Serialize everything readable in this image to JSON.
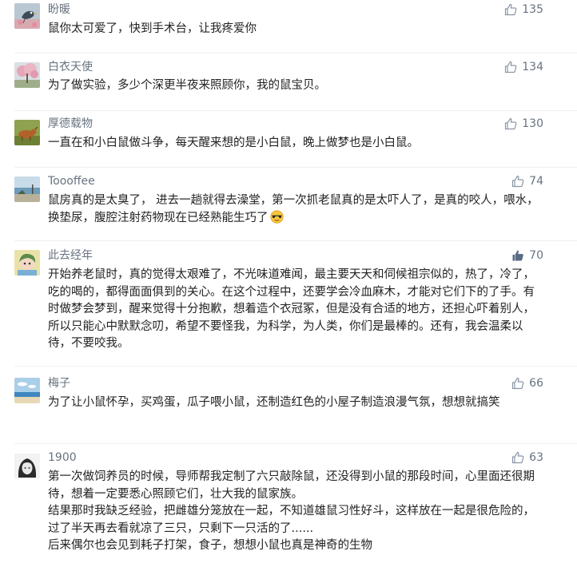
{
  "comments": [
    {
      "username": "盼暖",
      "likes": "135",
      "avatar_icon": "bird-avatar-icon",
      "lines": [
        "鼠你太可爱了，快到手术台，让我疼爱你"
      ]
    },
    {
      "username": "白衣天使",
      "likes": "134",
      "avatar_icon": "pink-tree-avatar-icon",
      "lines": [
        "为了做实验，多少个深更半夜来照顾你，我的鼠宝贝。"
      ]
    },
    {
      "username": "厚德载物",
      "likes": "130",
      "avatar_icon": "animal-grass-avatar-icon",
      "lines": [
        "一直在和小白鼠做斗争，每天醒来想的是小白鼠，晚上做梦也是小白鼠。"
      ]
    },
    {
      "username": "Toooffee",
      "likes": "74",
      "avatar_icon": "seaside-avatar-icon",
      "lines": [
        "鼠房真的是太臭了， 进去一趟就得去澡堂，第一次抓老鼠真的是太吓人了，是真的咬人，喂水，换垫尿，腹腔注射药物现在已经熟能生巧了"
      ],
      "trailing_emoji": "sunglasses-emoji-icon"
    },
    {
      "username": "此去经年",
      "likes": "70",
      "like_active": true,
      "avatar_icon": "anime-avatar-icon",
      "lines": [
        "开始养老鼠时，真的觉得太艰难了，不光味道难闻，最主要天天和伺候祖宗似的，热了，冷了，吃的喝的，都得面面俱到的关心。在这个过程中，还要学会冷血麻木，才能对它们下的了手。有时做梦会梦到，醒来觉得十分抱歉，想着造个衣冠冢，但是没有合适的地方，还担心吓着别人，所以只能心中默默念叨，希望不要怪我，为科学，为人类，你们是最棒的。还有，我会温柔以待，不要咬我。"
      ]
    },
    {
      "username": "梅子",
      "likes": "66",
      "avatar_icon": "sky-sea-avatar-icon",
      "lines": [
        "为了让小鼠怀孕，买鸡蛋，瓜子喂小鼠，还制造红色的小屋子制造浪漫气氛，想想就搞笑"
      ]
    },
    {
      "username": "1900",
      "likes": "63",
      "avatar_icon": "sketch-portrait-avatar-icon",
      "lines": [
        "第一次做饲养员的时候，导师帮我定制了六只敲除鼠，还没得到小鼠的那段时间，心里面还很期待，想着一定要悉心照顾它们，壮大我的鼠家族。",
        "结果那时我缺乏经验，把雌雄分笼放在一起，不知道雄鼠习性好斗，这样放在一起是很危险的，过了半天再去看就凉了三只，只剩下一只活的了......",
        "后来偶尔也会见到耗子打架，食子，想想小鼠也真是神奇的生物"
      ]
    }
  ],
  "colors": {
    "username": "#687380",
    "text": "#222222",
    "like_icon": "#8a96a6",
    "like_icon_active": "#5a6b85",
    "divider": "#eef0f2"
  }
}
